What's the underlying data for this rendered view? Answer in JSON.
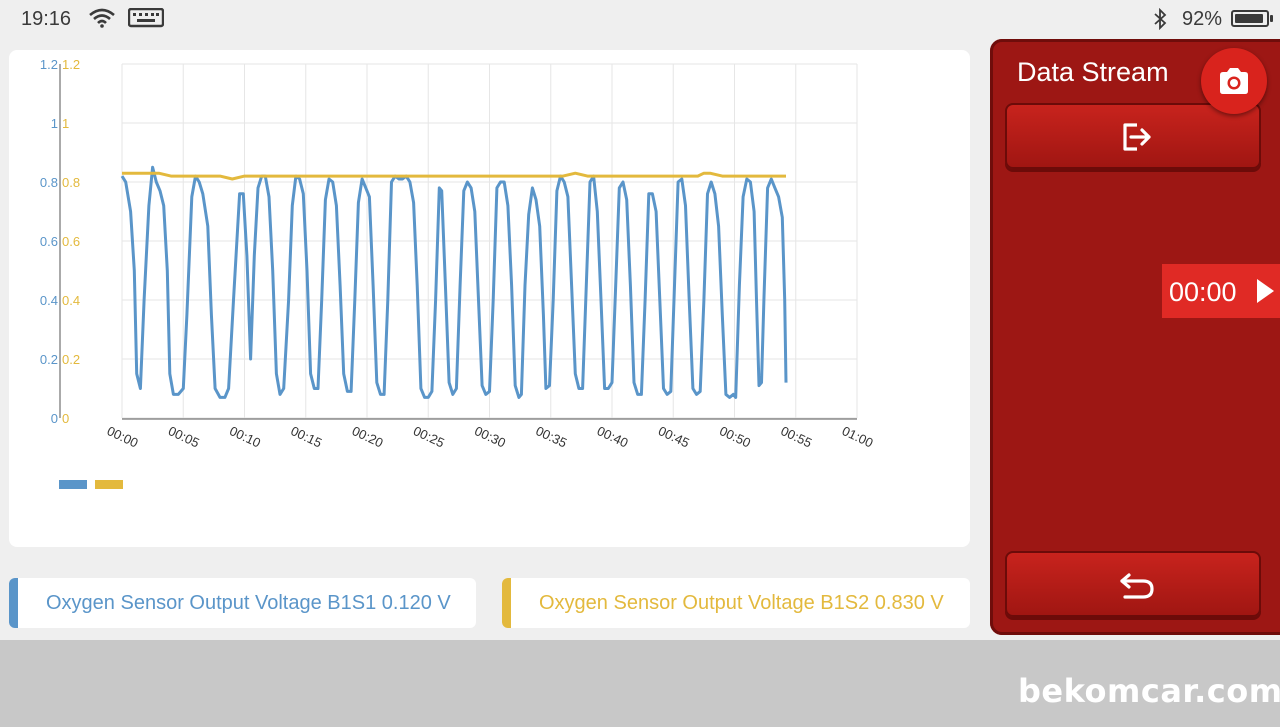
{
  "status_bar": {
    "time": "19:16",
    "battery_percent": "92%",
    "battery_level": 0.92,
    "icons": [
      "wifi-icon",
      "keyboard-icon",
      "bluetooth-icon",
      "battery-icon"
    ]
  },
  "panel": {
    "title": "Data Stream",
    "timer": "00:00",
    "icons": [
      "camera-icon",
      "exit-icon",
      "play-icon",
      "back-icon"
    ]
  },
  "sensors": [
    {
      "label": "Oxygen Sensor Output Voltage B1S1 0.120 V",
      "color": "#5a95c9"
    },
    {
      "label": "Oxygen Sensor Output Voltage B1S2 0.830 V",
      "color": "#e3b93d"
    }
  ],
  "watermark": "bekomcar.com",
  "chart_data": {
    "type": "line",
    "x_ticks": [
      "00:00",
      "00:05",
      "00:10",
      "00:15",
      "00:20",
      "00:25",
      "00:30",
      "00:35",
      "00:40",
      "00:45",
      "00:50",
      "00:55",
      "01:00"
    ],
    "x_range_seconds": [
      0,
      60
    ],
    "y_ticks_left": [
      "0",
      "0.2",
      "0.4",
      "0.6",
      "0.8",
      "1",
      "1.2"
    ],
    "y_ticks_right": [
      "0",
      "0.2",
      "0.4",
      "0.6",
      "0.8",
      "1",
      "1.2"
    ],
    "ylim": [
      0,
      1.2
    ],
    "grid": true,
    "legend_position": "bottom-left",
    "series": [
      {
        "color": "#5a95c9",
        "points": [
          [
            0.0,
            0.82
          ],
          [
            0.3,
            0.8
          ],
          [
            0.7,
            0.7
          ],
          [
            1.0,
            0.5
          ],
          [
            1.2,
            0.15
          ],
          [
            1.5,
            0.1
          ],
          [
            1.8,
            0.4
          ],
          [
            2.2,
            0.72
          ],
          [
            2.5,
            0.85
          ],
          [
            2.8,
            0.8
          ],
          [
            3.1,
            0.77
          ],
          [
            3.4,
            0.72
          ],
          [
            3.7,
            0.5
          ],
          [
            3.9,
            0.15
          ],
          [
            4.2,
            0.08
          ],
          [
            4.6,
            0.08
          ],
          [
            5.0,
            0.1
          ],
          [
            5.3,
            0.35
          ],
          [
            5.7,
            0.75
          ],
          [
            6.0,
            0.82
          ],
          [
            6.3,
            0.8
          ],
          [
            6.6,
            0.76
          ],
          [
            7.0,
            0.65
          ],
          [
            7.3,
            0.35
          ],
          [
            7.6,
            0.1
          ],
          [
            8.0,
            0.07
          ],
          [
            8.4,
            0.07
          ],
          [
            8.7,
            0.1
          ],
          [
            9.1,
            0.4
          ],
          [
            9.6,
            0.76
          ],
          [
            9.9,
            0.76
          ],
          [
            10.2,
            0.55
          ],
          [
            10.5,
            0.2
          ],
          [
            10.8,
            0.55
          ],
          [
            11.1,
            0.78
          ],
          [
            11.4,
            0.82
          ],
          [
            11.7,
            0.82
          ],
          [
            12.0,
            0.75
          ],
          [
            12.3,
            0.5
          ],
          [
            12.6,
            0.15
          ],
          [
            12.9,
            0.08
          ],
          [
            13.2,
            0.1
          ],
          [
            13.6,
            0.4
          ],
          [
            13.9,
            0.72
          ],
          [
            14.2,
            0.82
          ],
          [
            14.5,
            0.81
          ],
          [
            14.8,
            0.76
          ],
          [
            15.1,
            0.5
          ],
          [
            15.4,
            0.15
          ],
          [
            15.7,
            0.1
          ],
          [
            16.0,
            0.1
          ],
          [
            16.3,
            0.4
          ],
          [
            16.6,
            0.74
          ],
          [
            16.9,
            0.81
          ],
          [
            17.2,
            0.8
          ],
          [
            17.5,
            0.72
          ],
          [
            17.8,
            0.45
          ],
          [
            18.1,
            0.15
          ],
          [
            18.4,
            0.09
          ],
          [
            18.7,
            0.09
          ],
          [
            19.0,
            0.4
          ],
          [
            19.3,
            0.73
          ],
          [
            19.6,
            0.81
          ],
          [
            19.9,
            0.78
          ],
          [
            20.2,
            0.75
          ],
          [
            20.5,
            0.45
          ],
          [
            20.8,
            0.12
          ],
          [
            21.1,
            0.08
          ],
          [
            21.4,
            0.08
          ],
          [
            21.7,
            0.4
          ],
          [
            22.0,
            0.8
          ],
          [
            22.3,
            0.82
          ],
          [
            22.6,
            0.81
          ],
          [
            22.9,
            0.81
          ],
          [
            23.2,
            0.82
          ],
          [
            23.5,
            0.8
          ],
          [
            23.8,
            0.73
          ],
          [
            24.1,
            0.45
          ],
          [
            24.4,
            0.1
          ],
          [
            24.7,
            0.07
          ],
          [
            25.0,
            0.07
          ],
          [
            25.3,
            0.09
          ],
          [
            25.6,
            0.4
          ],
          [
            25.9,
            0.78
          ],
          [
            26.1,
            0.77
          ],
          [
            26.4,
            0.45
          ],
          [
            26.7,
            0.12
          ],
          [
            27.0,
            0.08
          ],
          [
            27.3,
            0.1
          ],
          [
            27.6,
            0.45
          ],
          [
            27.9,
            0.77
          ],
          [
            28.2,
            0.8
          ],
          [
            28.5,
            0.78
          ],
          [
            28.8,
            0.7
          ],
          [
            29.1,
            0.4
          ],
          [
            29.4,
            0.11
          ],
          [
            29.7,
            0.08
          ],
          [
            30.0,
            0.09
          ],
          [
            30.3,
            0.4
          ],
          [
            30.6,
            0.78
          ],
          [
            30.9,
            0.8
          ],
          [
            31.2,
            0.8
          ],
          [
            31.5,
            0.72
          ],
          [
            31.8,
            0.45
          ],
          [
            32.1,
            0.11
          ],
          [
            32.4,
            0.07
          ],
          [
            32.6,
            0.08
          ],
          [
            32.9,
            0.45
          ],
          [
            33.2,
            0.69
          ],
          [
            33.5,
            0.78
          ],
          [
            33.8,
            0.74
          ],
          [
            34.1,
            0.65
          ],
          [
            34.4,
            0.35
          ],
          [
            34.6,
            0.1
          ],
          [
            34.9,
            0.11
          ],
          [
            35.2,
            0.4
          ],
          [
            35.5,
            0.77
          ],
          [
            35.8,
            0.82
          ],
          [
            36.1,
            0.8
          ],
          [
            36.4,
            0.75
          ],
          [
            36.7,
            0.45
          ],
          [
            37.0,
            0.15
          ],
          [
            37.3,
            0.1
          ],
          [
            37.6,
            0.1
          ],
          [
            37.9,
            0.45
          ],
          [
            38.2,
            0.8
          ],
          [
            38.5,
            0.82
          ],
          [
            38.8,
            0.7
          ],
          [
            39.1,
            0.4
          ],
          [
            39.4,
            0.1
          ],
          [
            39.7,
            0.1
          ],
          [
            40.0,
            0.12
          ],
          [
            40.3,
            0.45
          ],
          [
            40.6,
            0.78
          ],
          [
            40.9,
            0.8
          ],
          [
            41.2,
            0.74
          ],
          [
            41.5,
            0.45
          ],
          [
            41.8,
            0.12
          ],
          [
            42.1,
            0.08
          ],
          [
            42.4,
            0.08
          ],
          [
            42.7,
            0.4
          ],
          [
            43.0,
            0.76
          ],
          [
            43.3,
            0.76
          ],
          [
            43.6,
            0.7
          ],
          [
            43.9,
            0.4
          ],
          [
            44.2,
            0.1
          ],
          [
            44.5,
            0.08
          ],
          [
            44.8,
            0.09
          ],
          [
            45.1,
            0.45
          ],
          [
            45.4,
            0.8
          ],
          [
            45.7,
            0.81
          ],
          [
            46.0,
            0.72
          ],
          [
            46.3,
            0.4
          ],
          [
            46.6,
            0.1
          ],
          [
            46.9,
            0.08
          ],
          [
            47.2,
            0.09
          ],
          [
            47.5,
            0.4
          ],
          [
            47.8,
            0.76
          ],
          [
            48.1,
            0.8
          ],
          [
            48.4,
            0.76
          ],
          [
            48.7,
            0.65
          ],
          [
            49.0,
            0.35
          ],
          [
            49.3,
            0.08
          ],
          [
            49.6,
            0.07
          ],
          [
            49.9,
            0.08
          ],
          [
            50.1,
            0.07
          ],
          [
            50.4,
            0.45
          ],
          [
            50.7,
            0.75
          ],
          [
            51.0,
            0.81
          ],
          [
            51.3,
            0.8
          ],
          [
            51.6,
            0.7
          ],
          [
            51.8,
            0.4
          ],
          [
            52.0,
            0.11
          ],
          [
            52.2,
            0.12
          ],
          [
            52.4,
            0.4
          ],
          [
            52.7,
            0.78
          ],
          [
            53.0,
            0.81
          ],
          [
            53.3,
            0.78
          ],
          [
            53.6,
            0.75
          ],
          [
            53.9,
            0.68
          ],
          [
            54.1,
            0.4
          ],
          [
            54.2,
            0.12
          ]
        ]
      },
      {
        "color": "#e3b93d",
        "points": [
          [
            0.0,
            0.83
          ],
          [
            1.0,
            0.83
          ],
          [
            2.0,
            0.83
          ],
          [
            3.0,
            0.83
          ],
          [
            4.0,
            0.82
          ],
          [
            5.0,
            0.82
          ],
          [
            6.0,
            0.82
          ],
          [
            7.0,
            0.82
          ],
          [
            8.0,
            0.82
          ],
          [
            9.0,
            0.81
          ],
          [
            10.0,
            0.82
          ],
          [
            11.0,
            0.82
          ],
          [
            12.0,
            0.82
          ],
          [
            13.0,
            0.82
          ],
          [
            14.0,
            0.82
          ],
          [
            15.0,
            0.82
          ],
          [
            16.0,
            0.82
          ],
          [
            17.0,
            0.82
          ],
          [
            18.0,
            0.82
          ],
          [
            19.0,
            0.82
          ],
          [
            20.0,
            0.82
          ],
          [
            21.0,
            0.82
          ],
          [
            22.0,
            0.82
          ],
          [
            23.0,
            0.82
          ],
          [
            24.0,
            0.82
          ],
          [
            25.0,
            0.82
          ],
          [
            26.0,
            0.82
          ],
          [
            27.0,
            0.82
          ],
          [
            28.0,
            0.82
          ],
          [
            29.0,
            0.82
          ],
          [
            30.0,
            0.82
          ],
          [
            31.0,
            0.82
          ],
          [
            32.0,
            0.82
          ],
          [
            33.0,
            0.82
          ],
          [
            34.0,
            0.82
          ],
          [
            35.0,
            0.82
          ],
          [
            36.0,
            0.82
          ],
          [
            37.0,
            0.83
          ],
          [
            38.0,
            0.82
          ],
          [
            39.0,
            0.82
          ],
          [
            40.0,
            0.82
          ],
          [
            41.0,
            0.82
          ],
          [
            42.0,
            0.82
          ],
          [
            43.0,
            0.82
          ],
          [
            44.0,
            0.82
          ],
          [
            45.0,
            0.82
          ],
          [
            46.0,
            0.82
          ],
          [
            47.0,
            0.82
          ],
          [
            47.5,
            0.83
          ],
          [
            48.0,
            0.83
          ],
          [
            49.0,
            0.82
          ],
          [
            50.0,
            0.82
          ],
          [
            51.0,
            0.82
          ],
          [
            52.0,
            0.82
          ],
          [
            53.0,
            0.82
          ],
          [
            54.0,
            0.82
          ],
          [
            54.2,
            0.82
          ]
        ]
      }
    ]
  }
}
